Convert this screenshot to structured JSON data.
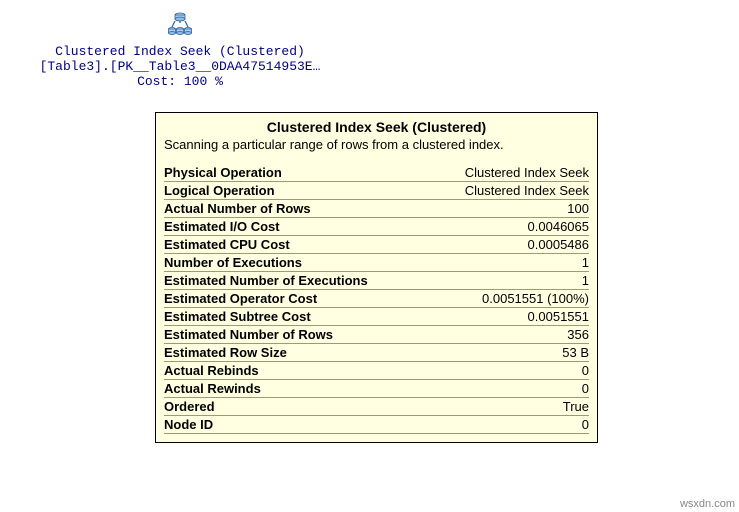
{
  "plan_node": {
    "icon_name": "clustered-index-seek-icon",
    "line1": "Clustered Index Seek (Clustered)",
    "line2": "[Table3].[PK__Table3__0DAA47514953E…",
    "line3": "Cost: 100 %"
  },
  "tooltip": {
    "title": "Clustered Index Seek (Clustered)",
    "description": "Scanning a particular range of rows from a clustered index.",
    "rows": [
      {
        "label": "Physical Operation",
        "value": "Clustered Index Seek"
      },
      {
        "label": "Logical Operation",
        "value": "Clustered Index Seek"
      },
      {
        "label": "Actual Number of Rows",
        "value": "100"
      },
      {
        "label": "Estimated I/O Cost",
        "value": "0.0046065"
      },
      {
        "label": "Estimated CPU Cost",
        "value": "0.0005486"
      },
      {
        "label": "Number of Executions",
        "value": "1"
      },
      {
        "label": "Estimated Number of Executions",
        "value": "1"
      },
      {
        "label": "Estimated Operator Cost",
        "value": "0.0051551 (100%)"
      },
      {
        "label": "Estimated Subtree Cost",
        "value": "0.0051551"
      },
      {
        "label": "Estimated Number of Rows",
        "value": "356"
      },
      {
        "label": "Estimated Row Size",
        "value": "53 B"
      },
      {
        "label": "Actual Rebinds",
        "value": "0"
      },
      {
        "label": "Actual Rewinds",
        "value": "0"
      },
      {
        "label": "Ordered",
        "value": "True"
      },
      {
        "label": "Node ID",
        "value": "0"
      }
    ]
  },
  "watermark": "wsxdn.com"
}
